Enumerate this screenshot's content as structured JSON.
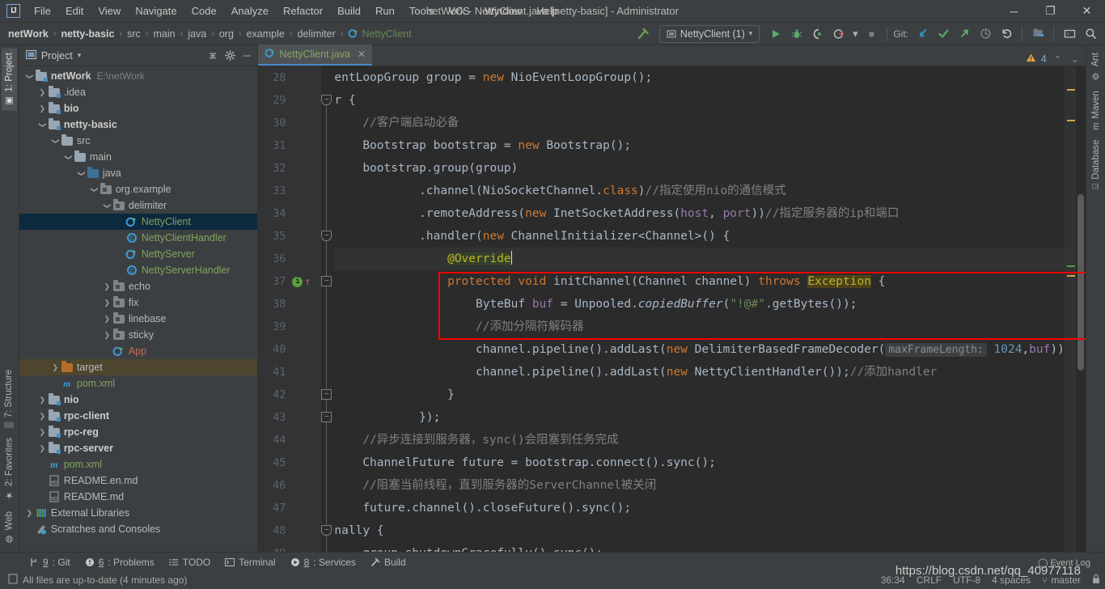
{
  "window": {
    "title": "netWork - NettyClient.java [netty-basic] - Administrator",
    "logo": "IJ",
    "minimize": "─",
    "maximize": "❐",
    "close": "✕"
  },
  "menubar": {
    "items": [
      {
        "label": "File"
      },
      {
        "label": "Edit"
      },
      {
        "label": "View"
      },
      {
        "label": "Navigate"
      },
      {
        "label": "Code"
      },
      {
        "label": "Analyze"
      },
      {
        "label": "Refactor"
      },
      {
        "label": "Build"
      },
      {
        "label": "Run"
      },
      {
        "label": "Tools"
      },
      {
        "label": "VCS"
      },
      {
        "label": "Window"
      },
      {
        "label": "Help"
      }
    ]
  },
  "breadcrumb": {
    "items": [
      {
        "label": "netWork",
        "style": "bold"
      },
      {
        "label": "netty-basic",
        "style": "bold"
      },
      {
        "label": "src",
        "style": "normal"
      },
      {
        "label": "main",
        "style": "normal"
      },
      {
        "label": "java",
        "style": "normal"
      },
      {
        "label": "org",
        "style": "normal"
      },
      {
        "label": "example",
        "style": "normal"
      },
      {
        "label": "delimiter",
        "style": "normal"
      },
      {
        "label": "NettyClient",
        "style": "green"
      }
    ],
    "separator": "›"
  },
  "toolbar": {
    "build_label": "build-hammer-icon",
    "run_config": "NettyClient (1)",
    "dropdown_arrow": "▾",
    "run_icon": "▶",
    "debug_icon": "debug-bug-icon",
    "run_coverage_icon": "run-with-coverage-icon",
    "profile_icon": "profiler-icon",
    "stop_icon": "■",
    "git_label": "Git:",
    "git_update_icon": "↙",
    "git_commit_icon": "✓",
    "git_push_icon": "↗",
    "git_history_icon": "◴",
    "git_rollback_icon": "↺",
    "project_structure_icon": "project-structure-icon",
    "terminal_icon": "terminal-icon",
    "search_icon": "⌕"
  },
  "stripe_left": {
    "top": [
      {
        "label": "1: Project",
        "icon": "▣",
        "active": true
      }
    ],
    "bottom": [
      {
        "label": "7: Structure",
        "icon": "▒"
      },
      {
        "label": "2: Favorites",
        "icon": "★"
      },
      {
        "label": "Web",
        "icon": "◍"
      }
    ]
  },
  "stripe_right": {
    "items": [
      {
        "label": "Ant",
        "icon": "⚙"
      },
      {
        "label": "Maven",
        "icon": "m"
      },
      {
        "label": "Database",
        "icon": "⌸"
      }
    ]
  },
  "project_panel": {
    "title": "Project",
    "title_caret": "▾",
    "panel_icon": "project-view-icon",
    "collapse_all_icon": "⨍",
    "settings_icon": "⚙",
    "hide_icon": "─",
    "tree": [
      {
        "depth": 0,
        "arrow": "down",
        "icon": "folder-module",
        "label": "netWork",
        "bold": true,
        "sub": "E:\\netWork"
      },
      {
        "depth": 1,
        "arrow": "right",
        "icon": "folder-module",
        "label": ".idea",
        "bold": false
      },
      {
        "depth": 1,
        "arrow": "right",
        "icon": "folder-module",
        "label": "bio",
        "bold": true
      },
      {
        "depth": 1,
        "arrow": "down",
        "icon": "folder-module",
        "label": "netty-basic",
        "bold": true
      },
      {
        "depth": 2,
        "arrow": "down",
        "icon": "folder",
        "label": "src",
        "bold": false
      },
      {
        "depth": 3,
        "arrow": "down",
        "icon": "folder",
        "label": "main",
        "bold": false
      },
      {
        "depth": 4,
        "arrow": "down",
        "icon": "folder-src",
        "label": "java",
        "bold": false
      },
      {
        "depth": 5,
        "arrow": "down",
        "icon": "folder-pkg",
        "label": "org.example",
        "bold": false
      },
      {
        "depth": 6,
        "arrow": "down",
        "icon": "folder-pkg",
        "label": "delimiter",
        "bold": false
      },
      {
        "depth": 7,
        "arrow": "none",
        "icon": "class-run",
        "label": "NettyClient",
        "bold": false,
        "state": "selected"
      },
      {
        "depth": 7,
        "arrow": "none",
        "icon": "class",
        "label": "NettyClientHandler",
        "bold": false
      },
      {
        "depth": 7,
        "arrow": "none",
        "icon": "class-run",
        "label": "NettyServer",
        "bold": false
      },
      {
        "depth": 7,
        "arrow": "none",
        "icon": "class",
        "label": "NettyServerHandler",
        "bold": false
      },
      {
        "depth": 6,
        "arrow": "right",
        "icon": "folder-pkg",
        "label": "echo",
        "bold": false
      },
      {
        "depth": 6,
        "arrow": "right",
        "icon": "folder-pkg",
        "label": "fix",
        "bold": false
      },
      {
        "depth": 6,
        "arrow": "right",
        "icon": "folder-pkg",
        "label": "linebase",
        "bold": false
      },
      {
        "depth": 6,
        "arrow": "right",
        "icon": "folder-pkg",
        "label": "sticky",
        "bold": false
      },
      {
        "depth": 6,
        "arrow": "none",
        "icon": "class-run-red",
        "label": "App",
        "bold": false
      },
      {
        "depth": 2,
        "arrow": "right",
        "icon": "folder-target",
        "label": "target",
        "bold": false,
        "state": "target"
      },
      {
        "depth": 2,
        "arrow": "none",
        "icon": "maven",
        "label": "pom.xml",
        "bold": false
      },
      {
        "depth": 1,
        "arrow": "right",
        "icon": "folder-module",
        "label": "nio",
        "bold": true
      },
      {
        "depth": 1,
        "arrow": "right",
        "icon": "folder-module",
        "label": "rpc-client",
        "bold": true
      },
      {
        "depth": 1,
        "arrow": "right",
        "icon": "folder-module",
        "label": "rpc-reg",
        "bold": true
      },
      {
        "depth": 1,
        "arrow": "right",
        "icon": "folder-module",
        "label": "rpc-server",
        "bold": true
      },
      {
        "depth": 1,
        "arrow": "none",
        "icon": "maven",
        "label": "pom.xml",
        "bold": false
      },
      {
        "depth": 1,
        "arrow": "none",
        "icon": "markdown",
        "label": "README.en.md",
        "bold": false
      },
      {
        "depth": 1,
        "arrow": "none",
        "icon": "markdown",
        "label": "README.md",
        "bold": false
      },
      {
        "depth": 0,
        "arrow": "right",
        "icon": "libraries",
        "label": "External Libraries",
        "bold": false
      },
      {
        "depth": 0,
        "arrow": "none",
        "icon": "scratches",
        "label": "Scratches and Consoles",
        "bold": false
      }
    ]
  },
  "editor": {
    "tab": {
      "label": "NettyClient.java",
      "close": "✕",
      "icon": "class-run"
    },
    "inspection": {
      "warning_icon": "⚠",
      "warning_count": "4",
      "up": "⌃",
      "down": "⌄"
    },
    "first_line_number": 28,
    "lines": [
      {
        "n": 28,
        "text": "entLoopGroup group = new NioEventLoopGroup();"
      },
      {
        "n": 29,
        "text": "r {"
      },
      {
        "n": 30,
        "text": "    //客户端启动必备"
      },
      {
        "n": 31,
        "text": "    Bootstrap bootstrap = new Bootstrap();"
      },
      {
        "n": 32,
        "text": "    bootstrap.group(group)"
      },
      {
        "n": 33,
        "text": "            .channel(NioSocketChannel.class)//指定使用nio的通信模式"
      },
      {
        "n": 34,
        "text": "            .remoteAddress(new InetSocketAddress(host, port))//指定服务器的ip和端口"
      },
      {
        "n": 35,
        "text": "            .handler(new ChannelInitializer<Channel>() {"
      },
      {
        "n": 36,
        "text": "                @Override"
      },
      {
        "n": 37,
        "text": "                protected void initChannel(Channel channel) throws Exception {"
      },
      {
        "n": 38,
        "text": "                    ByteBuf buf = Unpooled.copiedBuffer(\"!@#\".getBytes());"
      },
      {
        "n": 39,
        "text": "                    //添加分隔符解码器"
      },
      {
        "n": 40,
        "text": "                    channel.pipeline().addLast(new DelimiterBasedFrameDecoder( maxFrameLength: 1024,buf));"
      },
      {
        "n": 41,
        "text": "                    channel.pipeline().addLast(new NettyClientHandler());//添加handler"
      },
      {
        "n": 42,
        "text": "                }"
      },
      {
        "n": 43,
        "text": "            });"
      },
      {
        "n": 44,
        "text": "    //异步连接到服务器，sync()会阻塞到任务完成"
      },
      {
        "n": 45,
        "text": "    ChannelFuture future = bootstrap.connect().sync();"
      },
      {
        "n": 46,
        "text": "    //阻塞当前线程，直到服务器的ServerChannel被关闭"
      },
      {
        "n": 47,
        "text": "    future.channel().closeFuture().sync();"
      },
      {
        "n": 48,
        "text": "nally {"
      },
      {
        "n": 49,
        "text": "    group.shutdownGracefully().sync();"
      }
    ],
    "inlay_hint": "maxFrameLength:",
    "highlight_box_color": "#ff0000"
  },
  "tool_windows": {
    "items": [
      {
        "num": "9",
        "label": ": Git",
        "icon": "git-branch-icon"
      },
      {
        "num": "6",
        "label": ": Problems",
        "icon": "problems-icon"
      },
      {
        "num": "",
        "label": "TODO",
        "icon": "todo-icon"
      },
      {
        "num": "",
        "label": "Terminal",
        "icon": "terminal-icon"
      },
      {
        "num": "8",
        "label": ": Services",
        "icon": "services-icon"
      },
      {
        "num": "",
        "label": "Build",
        "icon": "build-hammer-icon"
      }
    ]
  },
  "statusbar": {
    "message": "All files are up-to-date (4 minutes ago)",
    "message_icon": "file-icon",
    "caret_position": "36:34",
    "line_separator": "CRLF",
    "encoding": "UTF-8",
    "indent": "4 spaces",
    "branch": "master",
    "branch_icon": "⑂",
    "lock_icon": "lock-icon",
    "event_log": "Event Log",
    "event_log_icon": "◯"
  },
  "watermark": "https://blog.csdn.net/qq_40977118"
}
